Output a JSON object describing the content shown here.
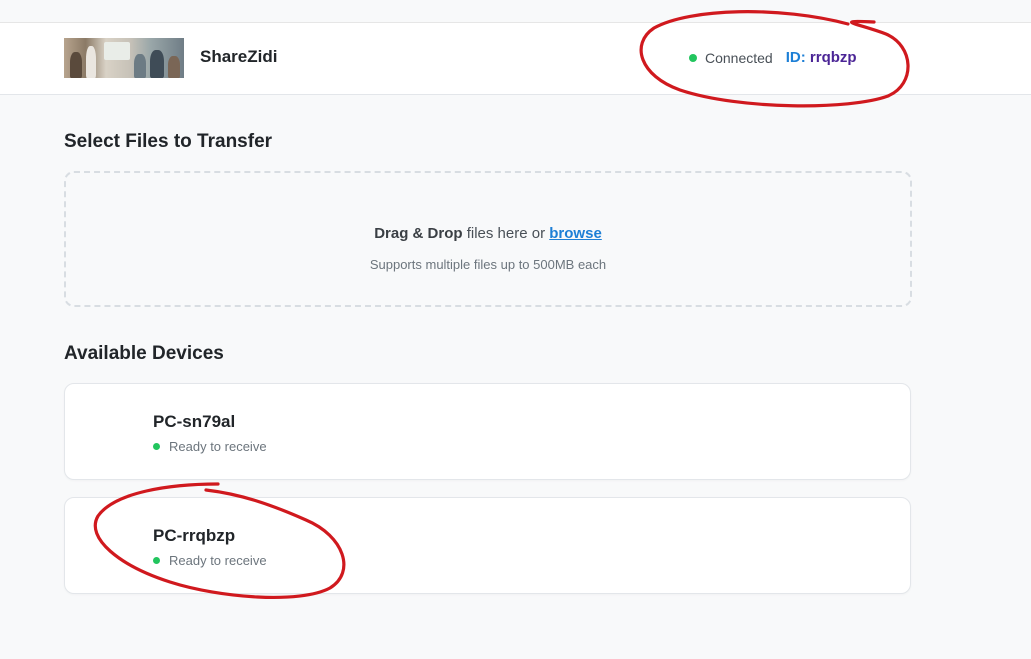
{
  "header": {
    "app_name": "ShareZidi",
    "logo_alt": "team photo",
    "connection_status": "Connected",
    "id_label": "ID:",
    "id_value": "rrqbzp"
  },
  "upload": {
    "title": "Select Files to Transfer",
    "drag_drop_bold": "Drag & Drop",
    "drag_drop_rest": " files here or ",
    "browse_link": "browse",
    "hint": "Supports multiple files up to 500MB each"
  },
  "devices": {
    "title": "Available Devices",
    "items": [
      {
        "name": "PC-sn79al",
        "status": "Ready to receive"
      },
      {
        "name": "PC-rrqbzp",
        "status": "Ready to receive"
      }
    ]
  },
  "colors": {
    "status_dot": "#22c55e",
    "accent_blue": "#1d7fd6",
    "id_value": "#4b2596",
    "annotation_red": "#d0191e"
  }
}
